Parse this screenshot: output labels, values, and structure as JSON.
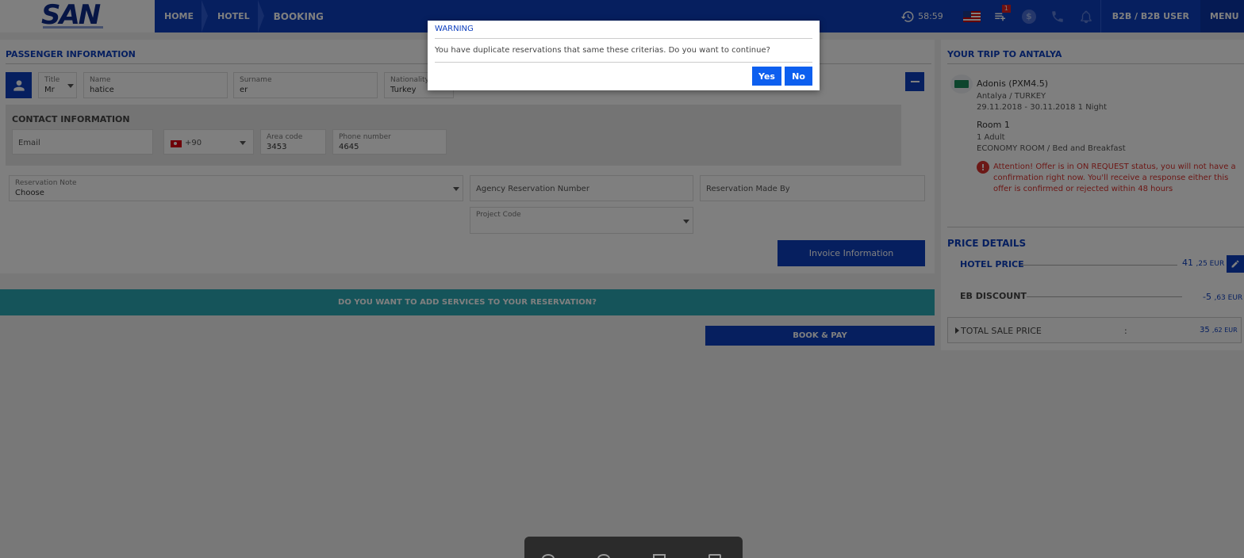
{
  "header": {
    "logo": "SAN",
    "breadcrumb": [
      "HOME",
      "HOTEL",
      "BOOKING"
    ],
    "timer": "58:59",
    "cart_badge": "1",
    "currency_symbol": "$",
    "user": "B2B / B2B USER",
    "menu": "MENU"
  },
  "passenger": {
    "section_title": "PASSENGER INFORMATION",
    "title_label": "Title",
    "title_value": "Mr",
    "name_label": "Name",
    "name_value": "hatice",
    "surname_label": "Surname",
    "surname_value": "er",
    "nationality_label": "Nationality",
    "nationality_value": "Turkey"
  },
  "contact": {
    "section_title": "CONTACT INFORMATION",
    "email_placeholder": "Email",
    "country_code": "+90",
    "area_code_label": "Area code",
    "area_code_value": "3453",
    "phone_label": "Phone number",
    "phone_value": "4645"
  },
  "reservation": {
    "note_label": "Reservation Note",
    "note_value": "Choose",
    "agency_number_placeholder": "Agency Reservation Number",
    "made_by_placeholder": "Reservation Made By",
    "project_code_label": "Project Code",
    "invoice_button": "Invoice Information"
  },
  "services_bar": "DO YOU WANT TO ADD SERVICES TO YOUR RESERVATION?",
  "book_pay": "BOOK & PAY",
  "trip": {
    "title": "YOUR TRIP TO ANTALYA",
    "hotel_name": "Adonis (PXM4.5)",
    "location": "Antalya / TURKEY",
    "dates": "29.11.2018 - 30.11.2018 1 Night",
    "room": "Room 1",
    "guests": "1 Adult",
    "room_type": "ECONOMY ROOM / Bed and Breakfast",
    "alert": "Attention! Offer is in ON REQUEST status, you will not have a confirmation right now. You'll receive a response either this offer is confirmed or rejected within 48 hours"
  },
  "price": {
    "title": "PRICE DETAILS",
    "hotel_price_label": "HOTEL PRICE",
    "hotel_price_int": "41",
    "hotel_price_dec": ",25 EUR",
    "discount_label": "EB DISCOUNT",
    "discount_int": "-5",
    "discount_dec": ",63 EUR",
    "total_label": "TOTAL SALE PRICE",
    "total_colon": ":",
    "total_int": "35",
    "total_dec": ",62 EUR"
  },
  "dialog": {
    "title": "WARNING",
    "message": "You have duplicate reservations that same these criterias. Do you want to continue?",
    "yes": "Yes",
    "no": "No"
  },
  "colors": {
    "primary": "#0d3fbf",
    "accent": "#0d5fef",
    "teal": "#2aa8b4",
    "alert": "#d9302c"
  }
}
